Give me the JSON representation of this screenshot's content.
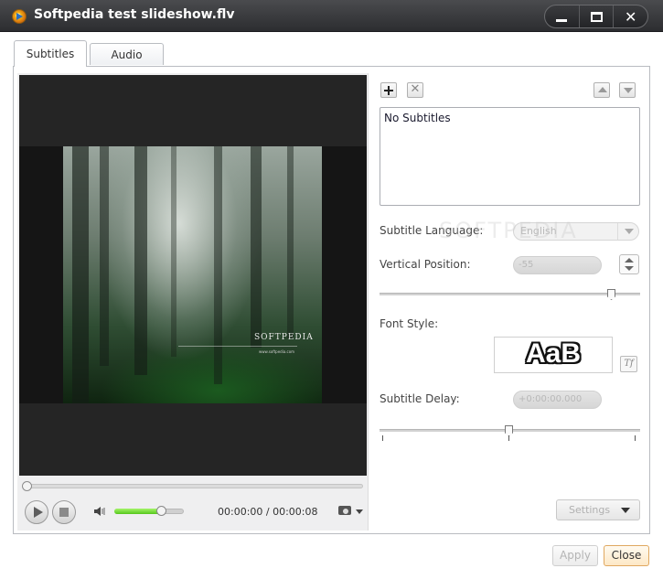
{
  "window": {
    "title": "Softpedia test slideshow.flv"
  },
  "tabs": [
    {
      "label": "Subtitles",
      "active": true
    },
    {
      "label": "Audio",
      "active": false
    }
  ],
  "player": {
    "time_current": "00:00:00",
    "time_total": "00:00:08",
    "time_separator": " / ",
    "time_readout": "00:00:00 / 00:00:08",
    "seek_position": 0,
    "volume_level": 0.7,
    "video_watermark_logo": "SOFTPEDIA",
    "video_watermark_url": "www.softpedia.com"
  },
  "subtitles": {
    "list_items": [
      "No Subtitles"
    ],
    "language_label": "Subtitle Language:",
    "language_value": "English",
    "vertical_position_label": "Vertical Position:",
    "vertical_position_value": "-55",
    "font_style_label": "Font Style:",
    "font_preview_text": "AaB",
    "delay_label": "Subtitle Delay:",
    "delay_value": "+0:00:00.000",
    "settings_label": "Settings"
  },
  "overlay_watermark": "SOFTPEDIA",
  "buttons": {
    "apply_label": "Apply",
    "close_label": "Close"
  },
  "icons": {
    "add": "plus-icon",
    "remove": "x-icon",
    "up": "arrow-up-icon",
    "down": "arrow-down-icon",
    "play": "play-icon",
    "stop": "stop-icon",
    "volume": "speaker-icon",
    "snapshot": "camera-icon",
    "font_settings": "font-icon"
  },
  "colors": {
    "titlebar": "#3a3b3e",
    "accent_close": "#e0a860",
    "volume_fill": "#55c61c"
  }
}
